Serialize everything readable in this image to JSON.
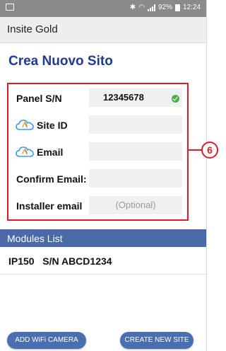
{
  "status_bar": {
    "battery": "92%",
    "time": "12:24",
    "icons": [
      "image-icon",
      "bluetooth-icon",
      "wifi-icon",
      "signal-icon",
      "battery-icon"
    ]
  },
  "app_bar": {
    "title": "Insite Gold"
  },
  "page": {
    "title": "Crea Nuovo Sito"
  },
  "form": {
    "panel_sn": {
      "label": "Panel S/N",
      "value": "12345678",
      "verified": true
    },
    "site_id": {
      "label": "Site ID",
      "value": "",
      "icon": "swan-cloud-icon"
    },
    "email": {
      "label": "Email",
      "value": "",
      "icon": "swan-cloud-icon"
    },
    "confirm_email": {
      "label": "Confirm Email:",
      "value": ""
    },
    "installer_email": {
      "label": "Installer email",
      "placeholder": "(Optional)"
    }
  },
  "annotation": {
    "number": "6",
    "color": "#e01b24"
  },
  "modules": {
    "header": "Modules List",
    "items": [
      {
        "text": "IP150   S/N ABCD1234"
      }
    ]
  },
  "buttons": {
    "add_camera": "ADD WiFi CAMERA",
    "create_site": "CREATE NEW SITE"
  },
  "colors": {
    "accent": "#1f3a93",
    "header_blue": "#4a6aa8",
    "button_blue": "#4a6fb0",
    "highlight_red": "#e01b24"
  }
}
